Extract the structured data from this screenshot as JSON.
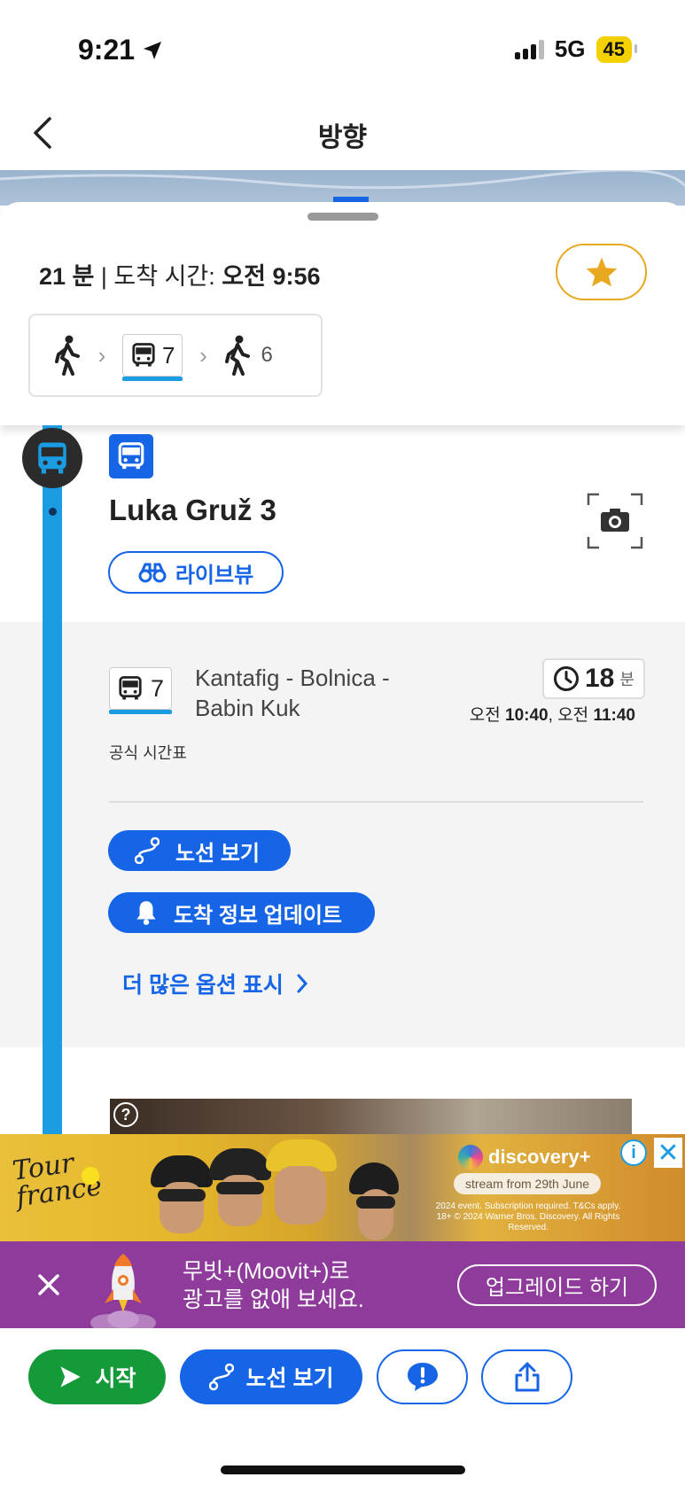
{
  "status_bar": {
    "time": "9:21",
    "network": "5G",
    "battery": "45"
  },
  "header": {
    "title": "방향"
  },
  "summary": {
    "duration": "21 분",
    "separator": " | ",
    "arrival_label": "도착 시간: ",
    "arrival_time": "오전 9:56"
  },
  "route_chips": {
    "bus_line": "7",
    "final_walk_minutes": "6"
  },
  "stop": {
    "name": "Luka Gruž 3",
    "liveview_label": "라이브뷰"
  },
  "line_detail": {
    "line_number": "7",
    "destination": "Kantafig - Bolnica - Babin Kuk",
    "eta_minutes": "18",
    "eta_unit": "분",
    "next_prefix_1": "오전 ",
    "next_time_1": "10:40",
    "next_separator": ", ",
    "next_prefix_2": "오전 ",
    "next_time_2": "11:40",
    "timetable_label": "공식 시간표",
    "route_button": "노선 보기",
    "alert_button": "도착 정보 업데이트",
    "more_options": "더 많은 옵션 표시"
  },
  "ad": {
    "logo_line1": "Tour",
    "logo_line2": "france",
    "brand": "discovery+",
    "cta": "stream from 29th June",
    "fine_print": "2024 event. Subscription required. T&Cs apply. 18+ © 2024 Warner Bros. Discovery. All Rights Reserved."
  },
  "promo": {
    "line1": "무빗+(Moovit+)로",
    "line2": "광고를 없애 보세요.",
    "upgrade_button": "업그레이드 하기"
  },
  "toolbar": {
    "start_label": "시작",
    "route_label": "노선 보기"
  },
  "colors": {
    "primary": "#1565e6",
    "line": "#1a9be2",
    "start": "#159a3a",
    "favorite": "#e8a820",
    "promo": "#8e3b9b"
  }
}
